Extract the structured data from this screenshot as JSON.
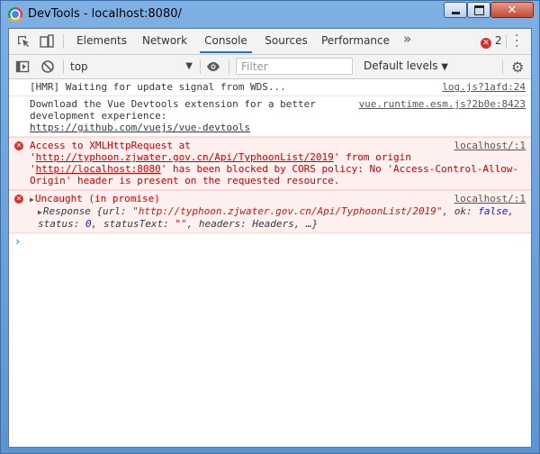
{
  "window": {
    "title": "DevTools - localhost:8080/"
  },
  "tabs": [
    {
      "label": "Elements"
    },
    {
      "label": "Network"
    },
    {
      "label": "Console"
    },
    {
      "label": "Sources"
    },
    {
      "label": "Performance"
    }
  ],
  "active_tab": "Console",
  "error_count": "2",
  "toolbar": {
    "context": "top",
    "filter_placeholder": "Filter",
    "levels_label": "Default levels"
  },
  "messages": [
    {
      "type": "log",
      "text": "[HMR] Waiting for update signal from WDS...",
      "source": "log.js?1afd:24"
    },
    {
      "type": "log",
      "text": "Download the Vue Devtools extension for a better development experience:",
      "link": "https://github.com/vuejs/vue-devtools",
      "source": "vue.runtime.esm.js?2b0e:8423"
    },
    {
      "type": "error",
      "p1": "Access to XMLHttpRequest at '",
      "url1": "http://typhoon.zjwater.gov.cn/Api/TyphoonList/2019",
      "p2": "' from origin '",
      "url2": "http://localhost:8080",
      "p3": "' has been blocked by CORS policy: No 'Access-Control-Allow-Origin' header is present on the requested resource.",
      "source": "localhost/:1"
    },
    {
      "type": "error",
      "text": "Uncaught (in promise)",
      "source": "localhost/:1",
      "resp_prefix": "Response {url: ",
      "resp_url": "\"http://typhoon.zjwater.gov.cn/Api/TyphoonList/2019\"",
      "resp_ok_label": ", ok: ",
      "resp_ok": "false",
      "resp_status_label": ", status: ",
      "resp_status": "0",
      "resp_statustext_label": ", statusText: ",
      "resp_statustext": "\"\"",
      "resp_suffix": ", headers: Headers, …}"
    }
  ],
  "colors": {
    "accent": "#1a73e8",
    "error": "#d93025",
    "error_text": "#c80000"
  }
}
